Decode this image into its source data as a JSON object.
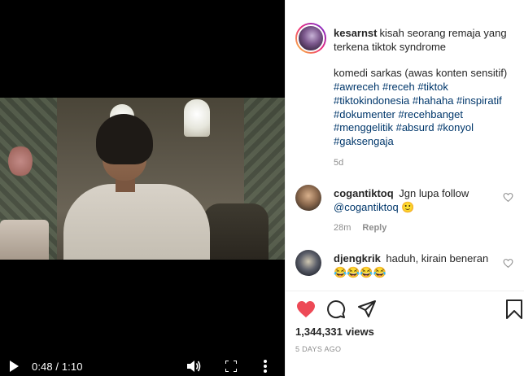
{
  "video": {
    "time": "0:48 / 1:10"
  },
  "post": {
    "username": "kesarnst",
    "caption_line1": "kisah seorang remaja yang terkena tiktok syndrome",
    "caption_line2": "komedi sarkas (awas konten sensitif)",
    "hashtags": "#awreceh #receh #tiktok #tiktokindonesia #hahaha #inspiratif #dokumenter #recehbanget #menggelitik #absurd #konyol #gaksengaja",
    "age": "5d"
  },
  "comments": [
    {
      "username": "cogantiktoq",
      "text": "Jgn lupa follow",
      "mention": "@cogantiktoq",
      "emoji": "🙂",
      "age": "28m",
      "reply_label": "Reply"
    },
    {
      "username": "djengkrik",
      "text": "haduh, kirain beneran",
      "emoji": "😂😂😂😂"
    }
  ],
  "stats": {
    "views_count": "1,344,331",
    "views_label": "views",
    "date": "5 DAYS AGO"
  },
  "colors": {
    "like": "#ed4956",
    "link": "#00376b",
    "muted": "#8e8e8e"
  },
  "icons": {
    "play": "play-icon",
    "volume": "volume-icon",
    "fullscreen": "fullscreen-icon",
    "more": "more-vertical-icon",
    "like": "heart-filled-icon",
    "comment": "comment-icon",
    "share": "share-icon",
    "save": "bookmark-icon"
  }
}
